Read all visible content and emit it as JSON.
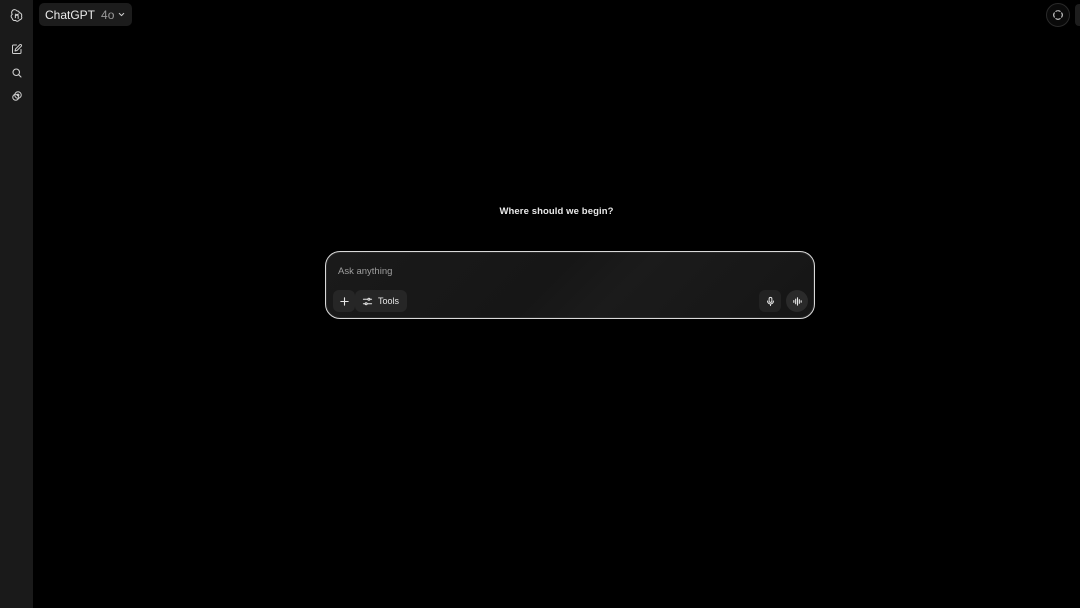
{
  "header": {
    "model_name": "ChatGPT",
    "model_version": "4o",
    "chevron_icon": "chevron-down-icon",
    "temporary_chat_icon": "dashed-circle-icon"
  },
  "sidebar": {
    "items": [
      {
        "name": "openai-logo",
        "icon": "openai-logo-icon"
      },
      {
        "name": "new-chat",
        "icon": "edit-icon"
      },
      {
        "name": "search-chats",
        "icon": "search-icon"
      },
      {
        "name": "library",
        "icon": "images-icon"
      }
    ]
  },
  "main": {
    "headline": "Where should we begin?"
  },
  "composer": {
    "placeholder": "Ask anything",
    "value": "",
    "tools_label": "Tools",
    "add_icon": "plus-icon",
    "tools_icon": "sliders-icon",
    "mic_icon": "microphone-icon",
    "voice_icon": "voice-waveform-icon"
  },
  "colors": {
    "background": "#000000",
    "sidebar": "#1a1a1a",
    "composer_border": "#d9d9d9",
    "text": "#ececec",
    "muted_text": "#9e9e9e"
  }
}
